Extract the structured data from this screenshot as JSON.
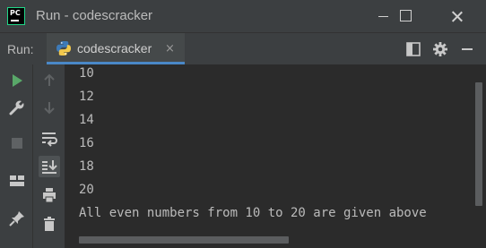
{
  "window": {
    "title": "Run - codescracker",
    "logo_text": "PC"
  },
  "toolwindow": {
    "label": "Run:",
    "tab": {
      "label": "codescracker",
      "close": "×"
    },
    "header_icons": [
      "layout-icon",
      "settings-icon",
      "hide-icon"
    ]
  },
  "left_toolbar": [
    "rerun-icon",
    "wrench-icon",
    "stop-icon",
    "layout-icon",
    "pin-icon"
  ],
  "second_toolbar": [
    "up-arrow-icon",
    "down-arrow-icon",
    "soft-wrap-icon",
    "scroll-to-end-icon",
    "print-icon",
    "trash-icon"
  ],
  "console": {
    "lines": [
      "10",
      "12",
      "14",
      "16",
      "18",
      "20",
      "All even numbers from 10 to 20 are given above"
    ]
  },
  "colors": {
    "background": "#2b2b2b",
    "panel": "#3c3f41",
    "text": "#bbbbbb",
    "run_green": "#59a869",
    "tab_accent": "#4a88c7"
  }
}
